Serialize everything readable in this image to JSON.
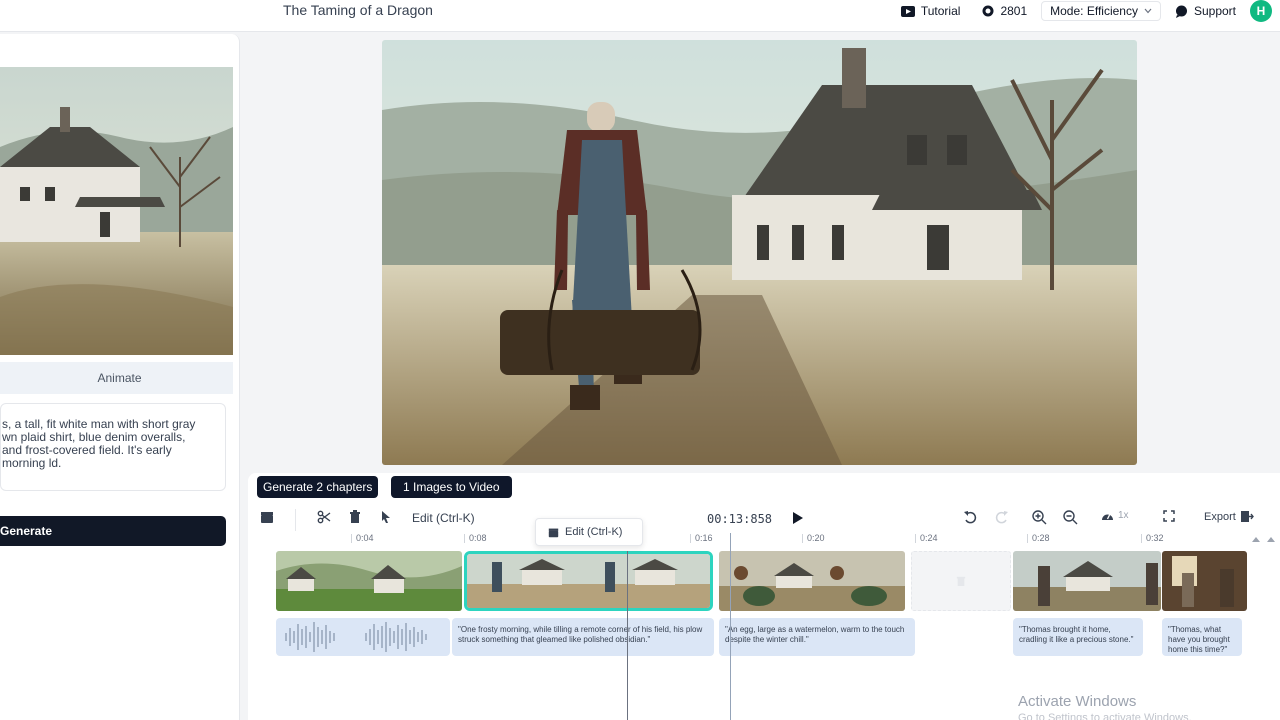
{
  "header": {
    "title": "The Taming of a Dragon",
    "tutorial_label": "Tutorial",
    "credits": "2801",
    "mode_label": "Mode: Efficiency",
    "support_label": "Support",
    "avatar_initial": "H",
    "avatar_color": "#10b981"
  },
  "left_panel": {
    "tab_animate": "Animate",
    "prompt_text": "s, a tall, fit white man with short gray wn plaid shirt, blue denim overalls, and frost-covered field.  It's early morning ld.",
    "generate_label": "Generate"
  },
  "timeline": {
    "generate_chapters_label": "Generate 2 chapters",
    "images_to_video_label": "1 Images to Video",
    "edit_label": "Edit (Ctrl-K)",
    "tooltip_label": "Edit (Ctrl-K)",
    "timecode": "00:13:858",
    "speed_label": "1x",
    "export_label": "Export",
    "ruler_ticks": [
      "0:04",
      "0:08",
      "0:16",
      "0:20",
      "0:24",
      "0:28",
      "0:32"
    ],
    "subtitles": [
      "\"One frosty morning, while tilling a remote corner of his field, his plow struck something that gleamed like polished obsidian.\"",
      "\"An egg, large as a watermelon, warm to the touch despite the winter chill.\"",
      "\"Thomas brought it home, cradling it like a precious stone.\"",
      "\"Thomas, what have you brought home this time?\""
    ],
    "selected_clip_color": "#2dd4bf"
  },
  "watermark": {
    "title": "Activate Windows",
    "subtitle": "Go to Settings to activate Windows."
  }
}
